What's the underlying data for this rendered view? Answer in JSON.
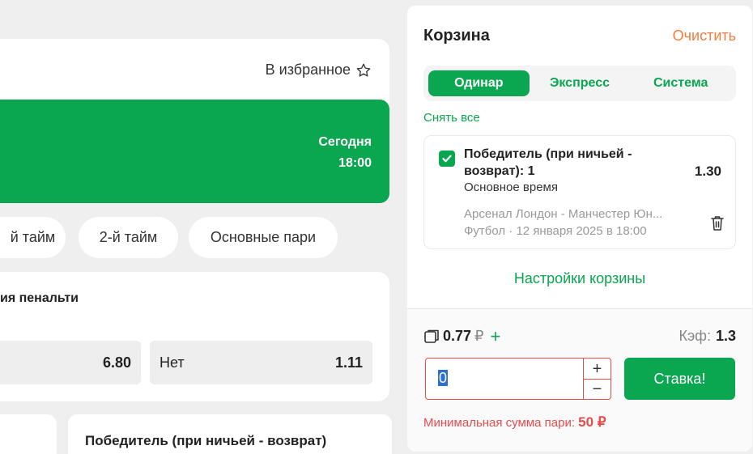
{
  "event": {
    "favorite_label": "В избранное",
    "date_day": "Сегодня",
    "date_time": "18:00"
  },
  "filters": [
    "й тайм",
    "2-й тайм",
    "Основные пари"
  ],
  "market": {
    "title": "ия пенальти",
    "odd1_value": "6.80",
    "odd2_label": "Нет",
    "odd2_value": "1.11"
  },
  "next_market": {
    "title": "Победитель (при ничьей - возврат)"
  },
  "cart": {
    "title": "Корзина",
    "clear_label": "Очистить",
    "tabs": [
      {
        "label": "Одинар",
        "active": true
      },
      {
        "label": "Экспресс",
        "active": false
      },
      {
        "label": "Система",
        "active": false
      }
    ],
    "remove_all_label": "Снять все",
    "bet": {
      "name": "Победитель (при ничьей - возврат): 1",
      "coef": "1.30",
      "sub": "Основное время",
      "event": "Арсенал Лондон - Манчестер Юн...",
      "meta": "Футбол · 12 января 2025 в 18:00"
    },
    "settings_label": "Настройки корзины",
    "bonus_value": "0.77",
    "bonus_currency": "₽",
    "coef_label": "Кэф:",
    "coef_value": "1.3",
    "stake_value": "0",
    "stepper_plus": "+",
    "stepper_minus": "−",
    "bet_button_label": "Ставка!",
    "min_note_label": "Минимальная сумма пари:",
    "min_note_value": "50 ₽"
  },
  "colors": {
    "accent": "#0aa650",
    "clear": "#f47c3c",
    "error": "#e84b4b"
  }
}
